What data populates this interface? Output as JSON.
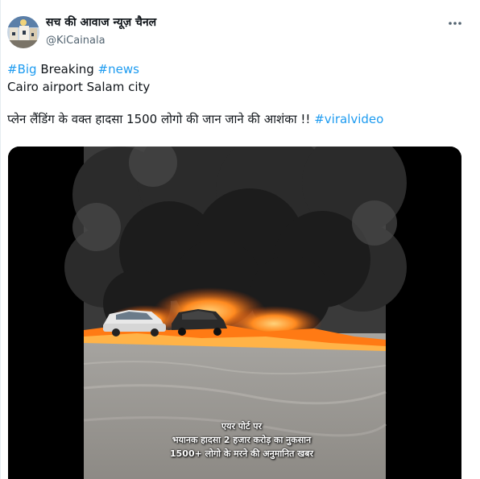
{
  "author": {
    "display_name": "सच की आवाज न्यूज़ चैनल",
    "handle": "@KiCainala"
  },
  "more_icon": "more-horizontal-icon",
  "tweet": {
    "line1": {
      "tag_big": "#Big",
      "word": " Breaking ",
      "tag_news": "#news"
    },
    "line2": "Cairo airport Salam city",
    "line3": {
      "text": "प्लेन लैंडिंग के वक्त हादसा 1500 लोगो की जान जाने की आशंका !! ",
      "tag": "#viralvideo"
    }
  },
  "media": {
    "overlay_caption": [
      "एयर पोर्ट पर",
      "भयानक हादसा 2 हजार करोड़ का नुकसान",
      "1500+ लोगो के मरने की अनुमानित खबर"
    ]
  },
  "colors": {
    "link": "#1d9bf0",
    "secondary_text": "#536471"
  }
}
